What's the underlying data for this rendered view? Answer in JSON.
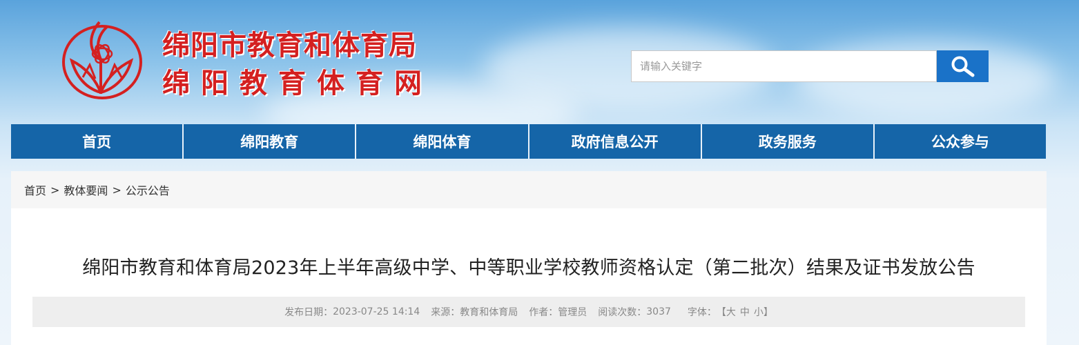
{
  "site": {
    "title_line1": "绵阳市教育和体育局",
    "title_line2": "绵阳教育体育网",
    "brand_color": "#d42020"
  },
  "search": {
    "placeholder": "请输入关键字",
    "value": "",
    "icon": "search-icon",
    "button_color": "#1a72c8"
  },
  "nav": {
    "items": [
      {
        "label": "首页"
      },
      {
        "label": "绵阳教育"
      },
      {
        "label": "绵阳体育"
      },
      {
        "label": "政府信息公开"
      },
      {
        "label": "政务服务"
      },
      {
        "label": "公众参与"
      }
    ],
    "color": "#1565a8"
  },
  "breadcrumb": {
    "items": [
      "首页",
      "教体要闻",
      "公示公告"
    ],
    "separator": ">"
  },
  "article": {
    "title": "绵阳市教育和体育局2023年上半年高级中学、中等职业学校教师资格认定（第二批次）结果及证书发放公告",
    "meta": {
      "date_label": "发布日期：",
      "date": "2023-07-25 14:14",
      "source_label": "来源：",
      "source": "教育和体育局",
      "author_label": "作者：",
      "author": "管理员",
      "views_label": "阅读次数：",
      "views": "3037",
      "font_label": "字体：",
      "font_open": "【",
      "font_large": "大",
      "font_medium": "中",
      "font_small": "小",
      "font_close": "】"
    }
  }
}
